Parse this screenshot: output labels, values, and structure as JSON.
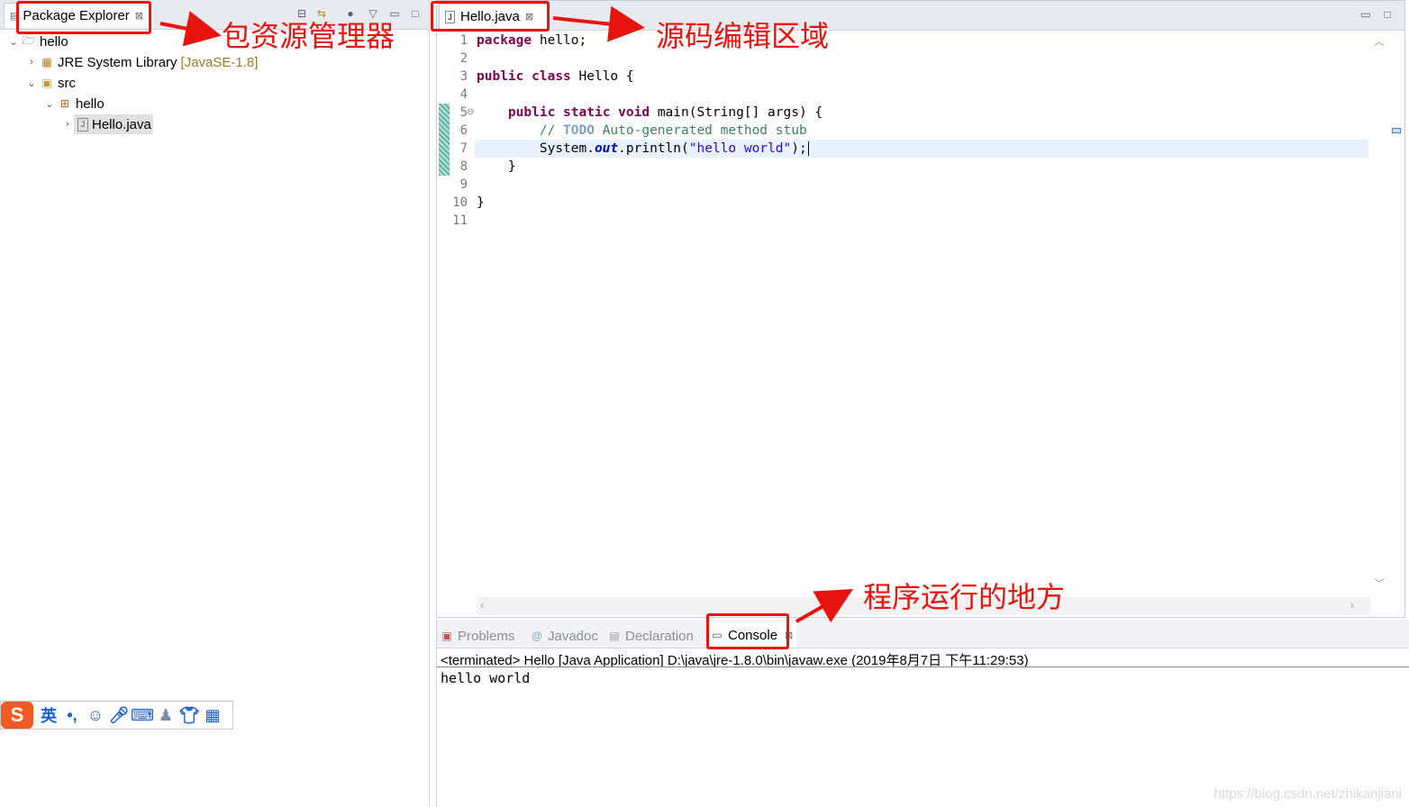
{
  "package_explorer": {
    "tab_label": "Package Explorer",
    "close_glyph": "⊠",
    "toolbar_icons": [
      "collapse-all-icon",
      "link-with-editor-icon",
      "focus-icon",
      "view-menu-icon",
      "minimize-icon",
      "maximize-icon"
    ],
    "tree": [
      {
        "label": "hello",
        "decor": "",
        "icon": "project-icon",
        "chevron": "expanded"
      },
      {
        "label": "JRE System Library",
        "decor": "[JavaSE-1.8]",
        "icon": "library-icon",
        "chevron": "collapsed"
      },
      {
        "label": "src",
        "decor": "",
        "icon": "source-folder-icon",
        "chevron": "expanded"
      },
      {
        "label": "hello",
        "decor": "",
        "icon": "package-icon",
        "chevron": "expanded"
      },
      {
        "label": "Hello.java",
        "decor": "",
        "icon": "java-file-icon",
        "chevron": "collapsed"
      }
    ]
  },
  "editor": {
    "tab_label": "Hello.java",
    "close_glyph": "⊠",
    "line_numbers": [
      "1",
      "2",
      "3",
      "4",
      "5",
      "6",
      "7",
      "8",
      "9",
      "10",
      "11"
    ],
    "code": {
      "l1_kw": "package",
      "l1_rest": " hello;",
      "l3_kw1": "public",
      "l3_kw2": "class",
      "l3_rest": " Hello {",
      "l5_kw1": "public",
      "l5_kw2": "static",
      "l5_kw3": "void",
      "l5_rest": " main(String[] args) {",
      "l6_comment_a": "// ",
      "l6_todo": "TODO",
      "l6_comment_b": " Auto-generated method stub",
      "l7_a": "System.",
      "l7_field": "out",
      "l7_b": ".println(",
      "l7_str": "\"hello world\"",
      "l7_c": ");",
      "l8": "    }",
      "l10": "}"
    },
    "fold_marker": "⊖"
  },
  "bottom_panel": {
    "tabs": [
      {
        "label": "Problems",
        "icon": "problems-icon"
      },
      {
        "label": "Javadoc",
        "icon": "javadoc-icon"
      },
      {
        "label": "Declaration",
        "icon": "declaration-icon"
      },
      {
        "label": "Console",
        "icon": "console-icon",
        "active": true
      }
    ],
    "console_description": "<terminated> Hello [Java Application] D:\\java\\jre-1.8.0\\bin\\javaw.exe (2019年8月7日 下午11:29:53)",
    "console_output": "hello world"
  },
  "annotations": {
    "package_explorer": "包资源管理器",
    "source_editor": "源码编辑区域",
    "console": "程序运行的地方"
  },
  "ime_toolbar": {
    "mode_label": "英",
    "icons": [
      "sogou-logo-icon",
      "punctuation-icon",
      "emoji-icon",
      "microphone-icon",
      "keyboard-icon",
      "user-tools-icon",
      "skin-shirt-icon",
      "apps-grid-icon"
    ]
  },
  "watermark": "https://blog.csdn.net/zhikanjiani",
  "colors": {
    "annotation_red": "#e8140f",
    "keyword": "#7f0055",
    "comment": "#3f7f5f",
    "string": "#2a00ff"
  }
}
